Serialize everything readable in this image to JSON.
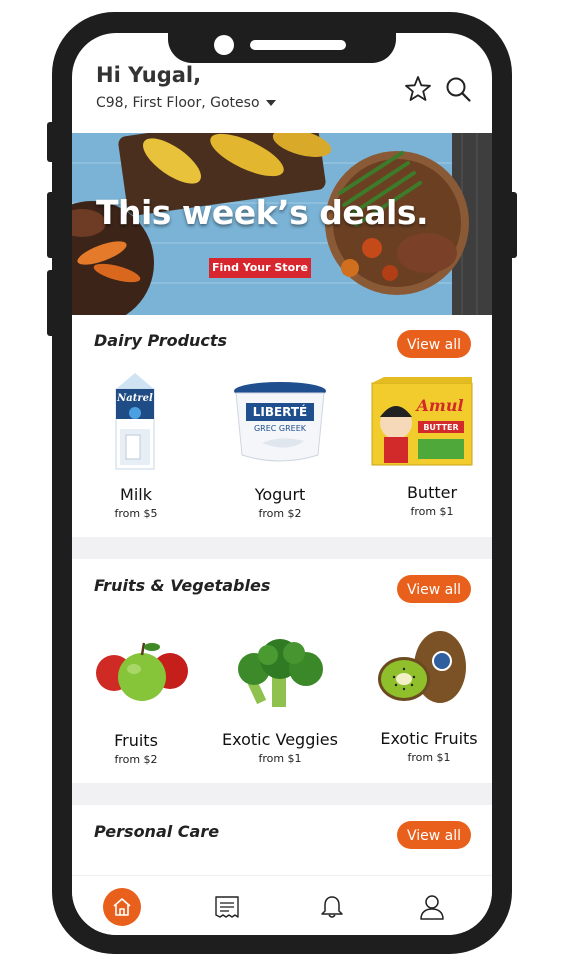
{
  "header": {
    "greeting": "Hi Yugal,",
    "address": "C98, First Floor, Goteso",
    "favorite_icon": "star-icon",
    "search_icon": "search-icon"
  },
  "banner": {
    "title": "This week’s deals.",
    "cta": "Find Your Store"
  },
  "sections": [
    {
      "title": "Dairy Products",
      "view_all": "View all",
      "products": [
        {
          "name": "Milk",
          "price": "from $5",
          "icon": "milk-carton"
        },
        {
          "name": "Yogurt",
          "price": "from $2",
          "icon": "yogurt-tub"
        },
        {
          "name": "Butter",
          "price": "from $1",
          "icon": "butter-pack"
        }
      ]
    },
    {
      "title": "Fruits & Vegetables",
      "view_all": "View all",
      "products": [
        {
          "name": "Fruits",
          "price": "from $2",
          "icon": "apples"
        },
        {
          "name": "Exotic Veggies",
          "price": "from $1",
          "icon": "broccoli"
        },
        {
          "name": "Exotic Fruits",
          "price": "from $1",
          "icon": "kiwi"
        }
      ]
    },
    {
      "title": "Personal Care",
      "view_all": "View all",
      "products": []
    }
  ],
  "tabbar": {
    "tabs": [
      "home-icon",
      "receipt-icon",
      "bell-icon",
      "user-icon"
    ],
    "active": "home-icon"
  },
  "colors": {
    "accent": "#e8601c",
    "deal_button": "#d8262e"
  }
}
